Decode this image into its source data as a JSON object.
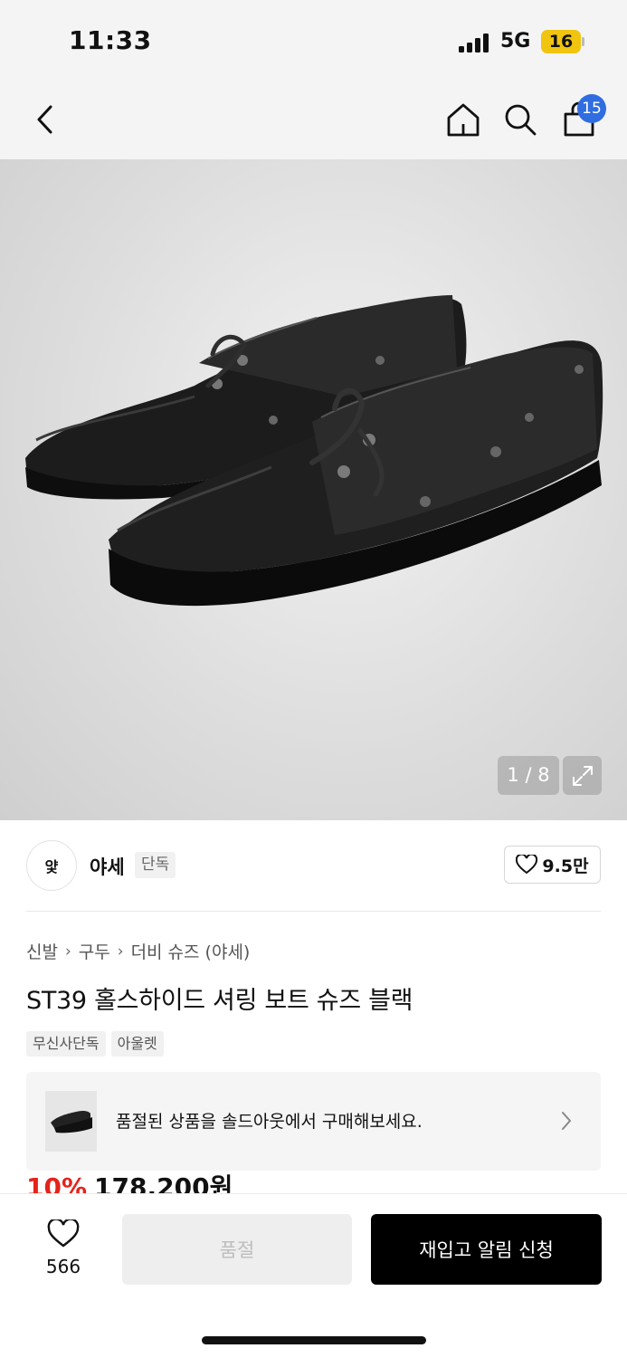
{
  "status_bar": {
    "time": "11:33",
    "network": "5G",
    "battery": "16"
  },
  "top_nav": {
    "cart_count": "15"
  },
  "gallery": {
    "counter": "1 / 8"
  },
  "brand": {
    "logo_text": "얓",
    "name": "야세",
    "tag": "단독",
    "likes": "9.5만"
  },
  "breadcrumb": [
    "신발",
    "구두",
    "더비 슈즈 (야세)"
  ],
  "product": {
    "title": "ST39 홀스하이드 셔링 보트 슈즈 블랙",
    "tags": [
      "무신사단독",
      "아울렛"
    ],
    "discount": "10%",
    "price": "178,200원"
  },
  "soldout_banner": {
    "text": "품절된 상품을 솔드아웃에서 구매해보세요."
  },
  "bottom_bar": {
    "wish_count": "566",
    "soldout_label": "품절",
    "restock_label": "재입고 알림 신청"
  },
  "colors": {
    "accent_blue": "#2f6de1",
    "discount_red": "#e5231b",
    "cta_black": "#000000"
  }
}
